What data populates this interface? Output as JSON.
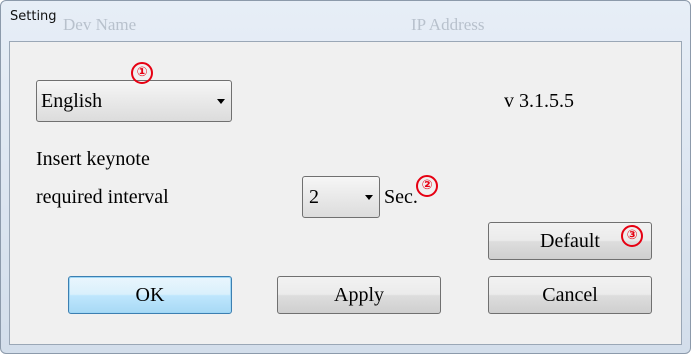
{
  "window": {
    "title": "Setting",
    "background_headers": [
      "Dev Name",
      "IP Address"
    ]
  },
  "language": {
    "selected": "English",
    "icon": "chevron-down-icon"
  },
  "version": "v 3.1.5.5",
  "keynote": {
    "line1": "Insert keynote",
    "line2": "required interval",
    "interval_value": "2",
    "unit": "Sec."
  },
  "buttons": {
    "default": "Default",
    "ok": "OK",
    "apply": "Apply",
    "cancel": "Cancel"
  },
  "annotations": [
    "①",
    "②",
    "③"
  ],
  "colors": {
    "annotation": "#e60012",
    "focus_button": "#bee6fd"
  }
}
